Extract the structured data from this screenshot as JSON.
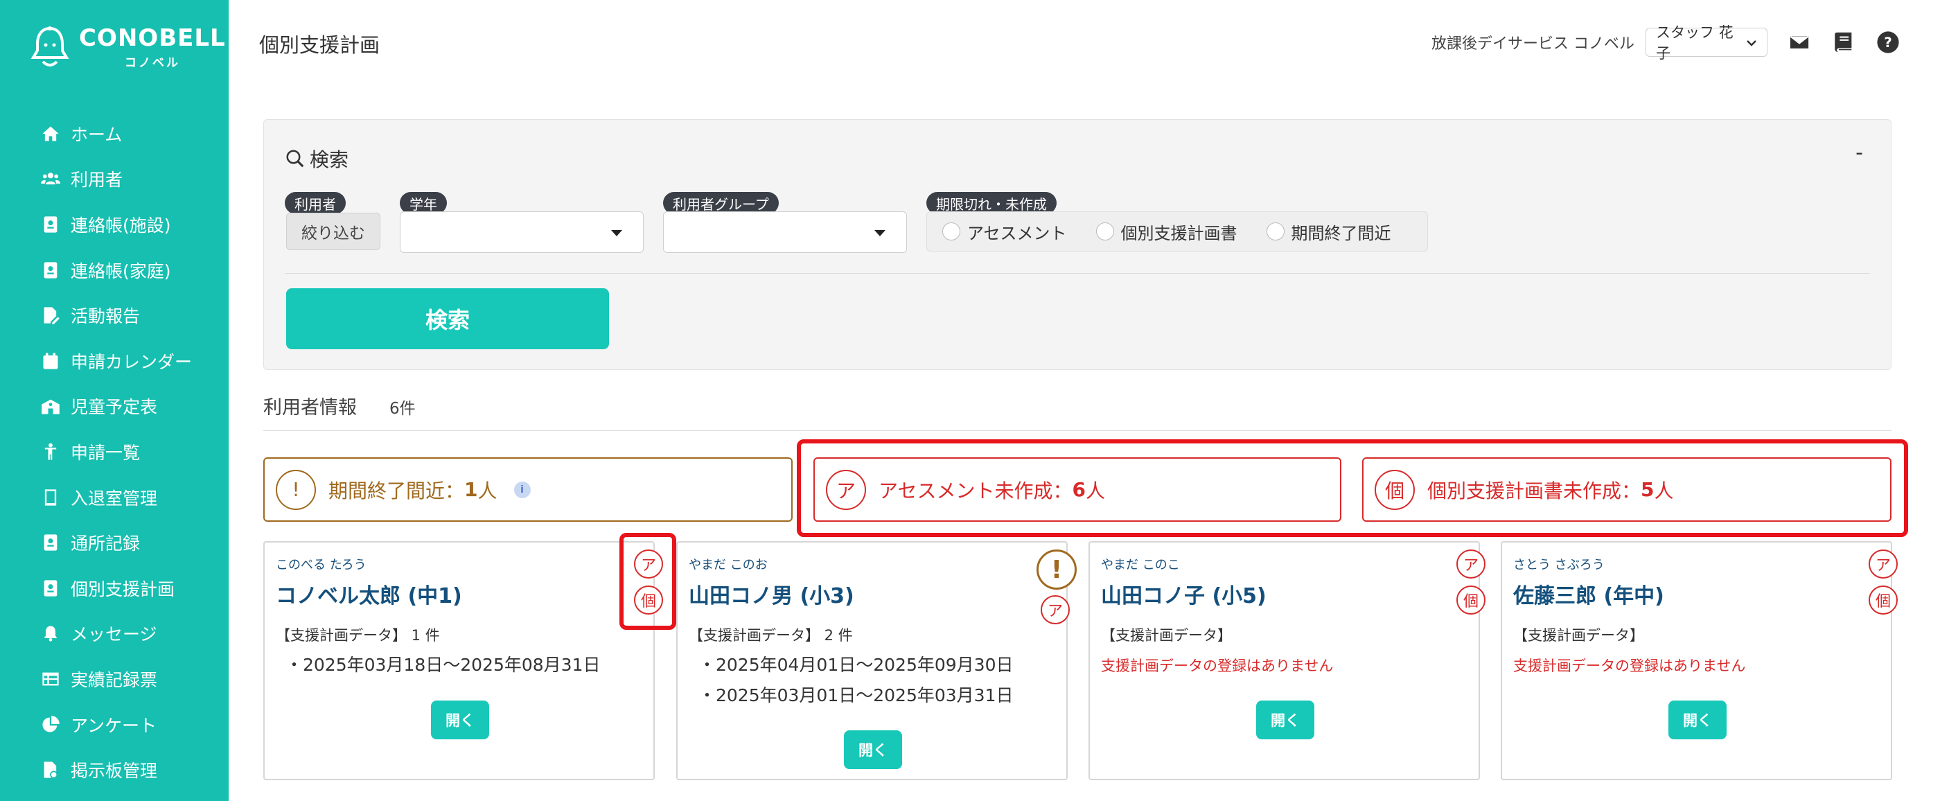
{
  "brand": {
    "name": "CONOBELL",
    "sub": "コノベル"
  },
  "sidebar": {
    "items": [
      {
        "label": "ホーム",
        "icon": "home-icon"
      },
      {
        "label": "利用者",
        "icon": "users-icon"
      },
      {
        "label": "連絡帳(施設)",
        "icon": "contact-book-icon"
      },
      {
        "label": "連絡帳(家庭)",
        "icon": "contact-book-icon"
      },
      {
        "label": "活動報告",
        "icon": "edit-document-icon"
      },
      {
        "label": "申請カレンダー",
        "icon": "calendar-icon"
      },
      {
        "label": "児童予定表",
        "icon": "school-icon"
      },
      {
        "label": "申請一覧",
        "icon": "child-icon"
      },
      {
        "label": "入退室管理",
        "icon": "tablet-icon"
      },
      {
        "label": "通所記録",
        "icon": "contact-book-icon"
      },
      {
        "label": "個別支援計画",
        "icon": "contact-book-icon"
      },
      {
        "label": "メッセージ",
        "icon": "bell-icon"
      },
      {
        "label": "実績記録票",
        "icon": "table-icon"
      },
      {
        "label": "アンケート",
        "icon": "pie-chart-icon"
      },
      {
        "label": "掲示板管理",
        "icon": "board-icon"
      }
    ]
  },
  "header": {
    "title": "個別支援計画",
    "facility": "放課後デイサービス コノベル",
    "staff": "スタッフ 花子"
  },
  "search": {
    "title": "検索",
    "collapse": "-",
    "label_user": "利用者",
    "label_grade": "学年",
    "label_group": "利用者グループ",
    "label_deadline": "期限切れ・未作成",
    "narrow": "絞り込む",
    "radios": [
      "アセスメント",
      "個別支援計画書",
      "期間終了間近"
    ],
    "button": "検索"
  },
  "users": {
    "heading": "利用者情報",
    "count": "6件"
  },
  "alerts": {
    "warn": {
      "badge": "!",
      "label": "期間終了間近：",
      "value": "1",
      "unit": "人",
      "info": "i"
    },
    "assessment": {
      "badge": "ア",
      "label": "アセスメント未作成：",
      "value": "6",
      "unit": "人"
    },
    "plan": {
      "badge": "個",
      "label": "個別支援計画書未作成：",
      "value": "5",
      "unit": "人"
    }
  },
  "cards": [
    {
      "kana": "このべる たろう",
      "name": "コノベル太郎 (中1)",
      "data": "【支援計画データ】 1 件",
      "lines": [
        "・2025年03月18日～2025年08月31日"
      ],
      "none": "",
      "badges": [
        "ア",
        "個"
      ],
      "open": "開く"
    },
    {
      "kana": "やまだ このお",
      "name": "山田コノ男 (小3)",
      "data": "【支援計画データ】 2 件",
      "lines": [
        "・2025年04月01日～2025年09月30日",
        "・2025年03月01日～2025年03月31日"
      ],
      "none": "",
      "badges": [
        "!",
        "ア"
      ],
      "open": "開く"
    },
    {
      "kana": "やまだ このこ",
      "name": "山田コノ子 (小5)",
      "data": "【支援計画データ】",
      "lines": [],
      "none": "支援計画データの登録はありません",
      "badges": [
        "ア",
        "個"
      ],
      "open": "開く"
    },
    {
      "kana": "さとう さぶろう",
      "name": "佐藤三郎 (年中)",
      "data": "【支援計画データ】",
      "lines": [],
      "none": "支援計画データの登録はありません",
      "badges": [
        "ア",
        "個"
      ],
      "open": "開く"
    }
  ],
  "colors": {
    "sidebar": "#17bfb0",
    "primary_button": "#17c8b8",
    "warning": "#a0691e",
    "danger": "#d82a2a",
    "highlight": "#e8141b",
    "name_text": "#14507d"
  }
}
